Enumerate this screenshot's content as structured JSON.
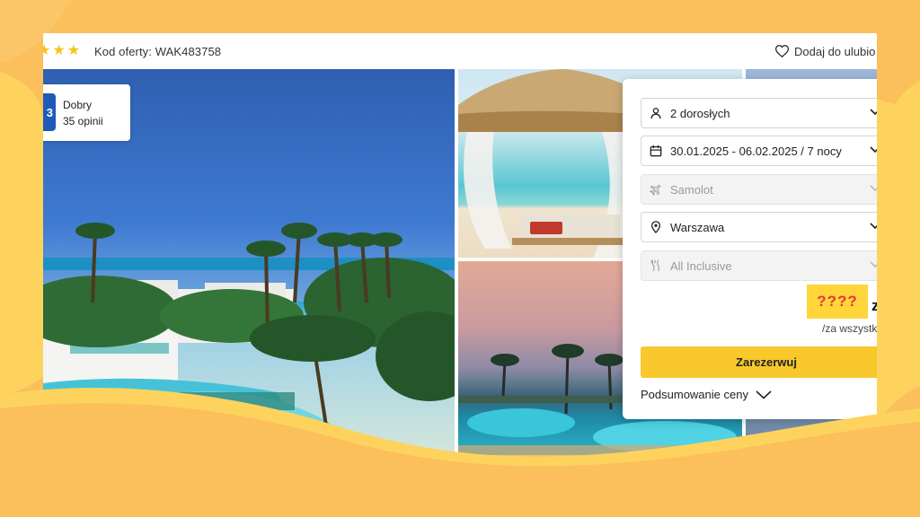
{
  "topbar": {
    "stars": [
      "★",
      "★",
      "★"
    ],
    "offer_code": "Kod oferty: WAK483758",
    "favorite_label": "Dodaj do ulubio",
    "heart_icon": "heart-icon"
  },
  "rating": {
    "score": "3",
    "label": "Dobry",
    "reviews": "35 opinii"
  },
  "booking": {
    "travelers": "2 dorosłych",
    "dates": "30.01.2025 - 06.02.2025 / 7 nocy",
    "transport": "Samolot",
    "departure": "Warszawa",
    "board": "All Inclusive",
    "price_placeholder": "????",
    "price_currency": "zł",
    "price_note": "/za wszystkich",
    "book_label": "Zarezerwuj",
    "summary_label": "Podsumowanie ceny"
  },
  "colors": {
    "background": "#FBBF5C",
    "wave_yellow": "#FDD35E",
    "accent_yellow": "#F8C82C",
    "rating_blue": "#1F5AB8",
    "price_red": "#E53935"
  }
}
